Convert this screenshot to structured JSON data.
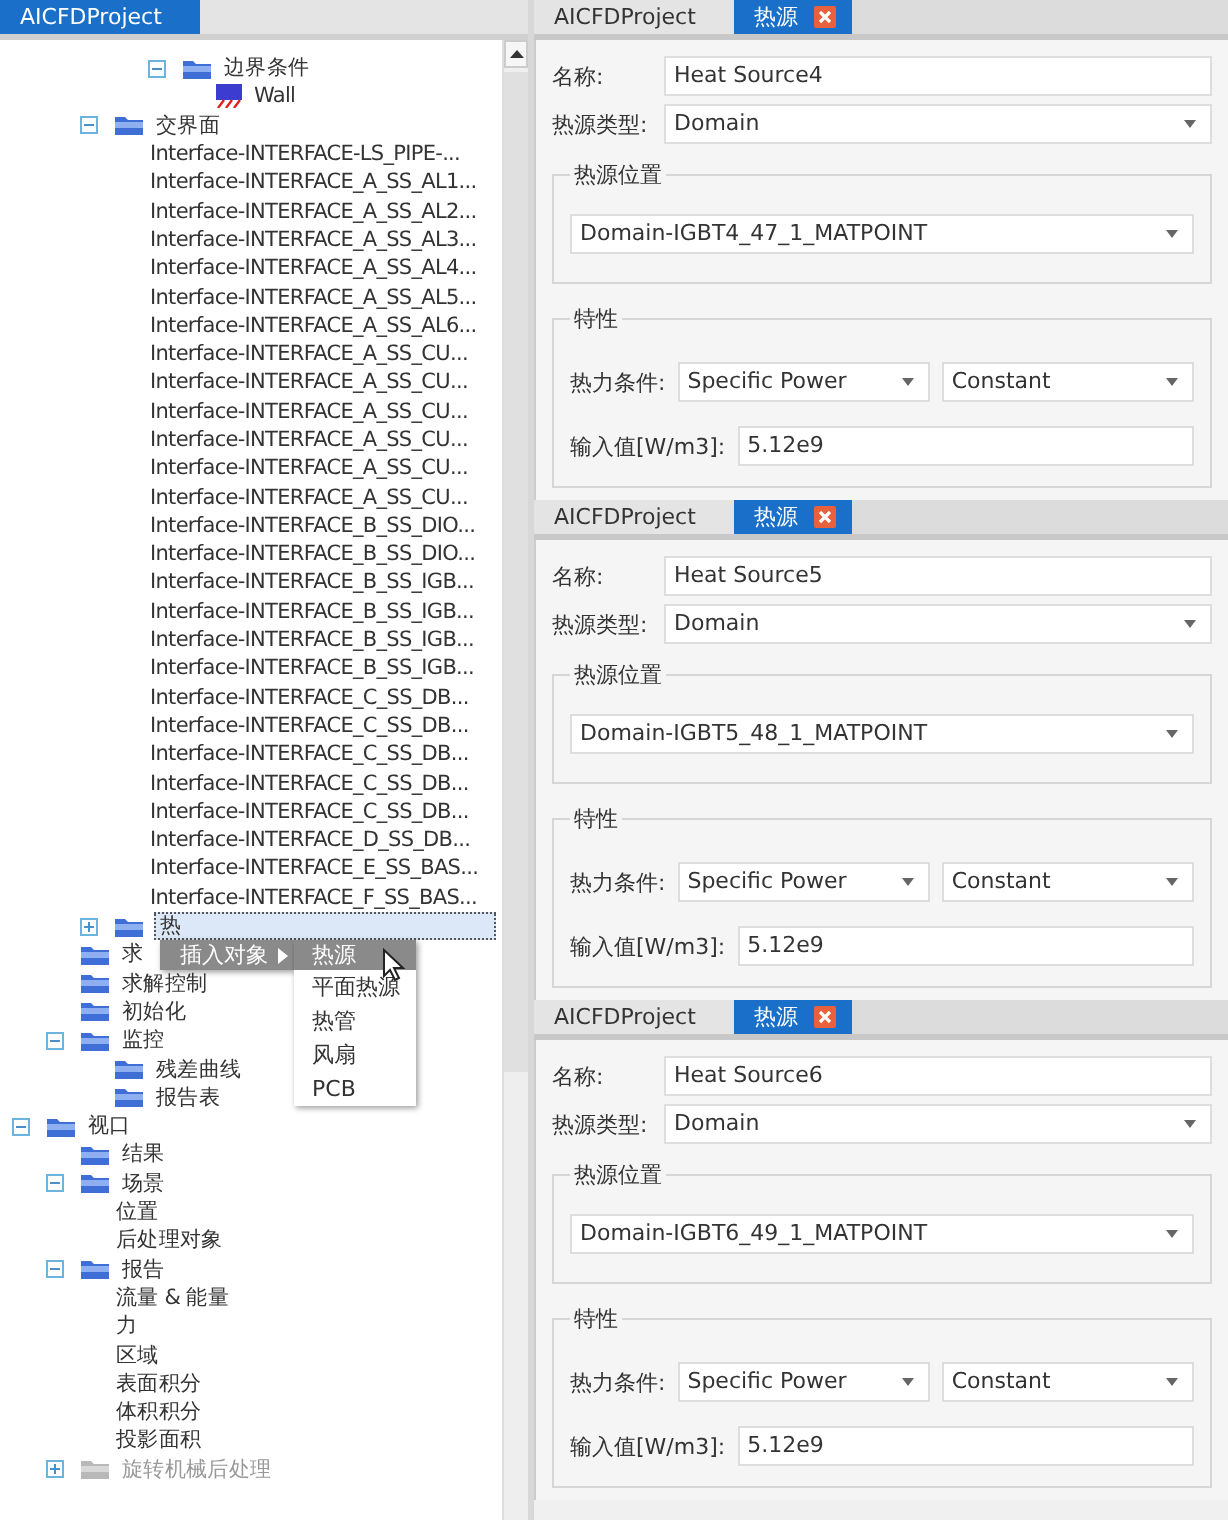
{
  "project_panel": {
    "tab": {
      "label": "AICFDProject",
      "selected": true
    },
    "tree": [
      {
        "children": [
          {
            "children": [
              {
                "children": [
                  {
                    "children": [
                      {
                        "label": "边界条件",
                        "kind": "folder",
                        "expanded": true,
                        "selected": false,
                        "children": [
                          {
                            "label": "Wall",
                            "kind": "wall",
                            "selected": false
                          }
                        ]
                      }
                    ]
                  }
                ]
              },
              {
                "label": "交界面",
                "kind": "folder",
                "expanded": true,
                "selected": false,
                "children": [
                  {
                    "label": "Interface-INTERFACE-LS_PIPE-...",
                    "selected": false
                  },
                  {
                    "label": "Interface-INTERFACE_A_SS_AL1...",
                    "selected": false
                  },
                  {
                    "label": "Interface-INTERFACE_A_SS_AL2...",
                    "selected": false
                  },
                  {
                    "label": "Interface-INTERFACE_A_SS_AL3...",
                    "selected": false
                  },
                  {
                    "label": "Interface-INTERFACE_A_SS_AL4...",
                    "selected": false
                  },
                  {
                    "label": "Interface-INTERFACE_A_SS_AL5...",
                    "selected": false
                  },
                  {
                    "label": "Interface-INTERFACE_A_SS_AL6...",
                    "selected": false
                  },
                  {
                    "label": "Interface-INTERFACE_A_SS_CU...",
                    "selected": false
                  },
                  {
                    "label": "Interface-INTERFACE_A_SS_CU...",
                    "selected": false
                  },
                  {
                    "label": "Interface-INTERFACE_A_SS_CU...",
                    "selected": false
                  },
                  {
                    "label": "Interface-INTERFACE_A_SS_CU...",
                    "selected": false
                  },
                  {
                    "label": "Interface-INTERFACE_A_SS_CU...",
                    "selected": false
                  },
                  {
                    "label": "Interface-INTERFACE_A_SS_CU...",
                    "selected": false
                  },
                  {
                    "label": "Interface-INTERFACE_B_SS_DIO...",
                    "selected": false
                  },
                  {
                    "label": "Interface-INTERFACE_B_SS_DIO...",
                    "selected": false
                  },
                  {
                    "label": "Interface-INTERFACE_B_SS_IGB...",
                    "selected": false
                  },
                  {
                    "label": "Interface-INTERFACE_B_SS_IGB...",
                    "selected": false
                  },
                  {
                    "label": "Interface-INTERFACE_B_SS_IGB...",
                    "selected": false
                  },
                  {
                    "label": "Interface-INTERFACE_B_SS_IGB...",
                    "selected": false
                  },
                  {
                    "label": "Interface-INTERFACE_C_SS_DB...",
                    "selected": false
                  },
                  {
                    "label": "Interface-INTERFACE_C_SS_DB...",
                    "selected": false
                  },
                  {
                    "label": "Interface-INTERFACE_C_SS_DB...",
                    "selected": false
                  },
                  {
                    "label": "Interface-INTERFACE_C_SS_DB...",
                    "selected": false
                  },
                  {
                    "label": "Interface-INTERFACE_C_SS_DB...",
                    "selected": false
                  },
                  {
                    "label": "Interface-INTERFACE_D_SS_DB...",
                    "selected": false
                  },
                  {
                    "label": "Interface-INTERFACE_E_SS_BAS...",
                    "selected": false
                  },
                  {
                    "label": "Interface-INTERFACE_F_SS_BAS...",
                    "selected": false
                  }
                ]
              },
              {
                "label": "热",
                "kind": "folder",
                "expanded": false,
                "selected": true
              }
            ]
          },
          {
            "label": "求",
            "kind": "folder",
            "selected": false
          },
          {
            "label": "求解控制",
            "kind": "folder",
            "selected": false
          },
          {
            "label": "初始化",
            "kind": "folder",
            "selected": false
          },
          {
            "label": "监控",
            "kind": "folder",
            "expanded": true,
            "selected": false,
            "children": [
              {
                "label": "残差曲线",
                "kind": "folder",
                "selected": false
              },
              {
                "label": "报告表",
                "kind": "folder",
                "selected": false
              }
            ]
          }
        ]
      },
      {
        "label": "视口",
        "kind": "folder",
        "expanded": true,
        "selected": false,
        "children": [
          {
            "label": "结果",
            "kind": "folder",
            "selected": false
          },
          {
            "label": "场景",
            "kind": "folder",
            "expanded": true,
            "selected": false,
            "children": [
              {
                "label": "位置",
                "selected": false
              },
              {
                "label": "后处理对象",
                "selected": false
              }
            ]
          },
          {
            "label": "报告",
            "kind": "folder",
            "expanded": true,
            "selected": false,
            "children": [
              {
                "label": "流量 & 能量",
                "selected": false
              },
              {
                "label": "力",
                "selected": false
              },
              {
                "label": "区域",
                "selected": false
              },
              {
                "label": "表面积分",
                "selected": false
              },
              {
                "label": "体积积分",
                "selected": false
              },
              {
                "label": "投影面积",
                "selected": false
              }
            ]
          },
          {
            "label": "旋转机械后处理",
            "kind": "folder-grey",
            "expanded": false,
            "selected": false
          }
        ]
      }
    ],
    "context_menu": {
      "label": "插入对象",
      "submenu": [
        {
          "label": "热源",
          "selected": true
        },
        {
          "label": "平面热源",
          "selected": false
        },
        {
          "label": "热管",
          "selected": false
        },
        {
          "label": "风扇",
          "selected": false
        },
        {
          "label": "PCB",
          "selected": false
        }
      ]
    }
  },
  "heat_source_panels": [
    {
      "tabs": [
        {
          "label": "AICFDProject",
          "selected": false,
          "closable": false
        },
        {
          "label": "热源",
          "selected": true,
          "closable": true
        }
      ],
      "name_label": "名称:",
      "name": "Heat Source4",
      "type_label": "热源类型:",
      "type": "Domain",
      "location_group": "热源位置",
      "location": "Domain-IGBT4_47_1_MATPOINT",
      "properties_group": "特性",
      "condition_label": "热力条件:",
      "condition": "Specific Power",
      "profile": "Constant",
      "value_label": "输入值[W/m3]:",
      "value": "5.12e9"
    },
    {
      "tabs": [
        {
          "label": "AICFDProject",
          "selected": false,
          "closable": false
        },
        {
          "label": "热源",
          "selected": true,
          "closable": true
        }
      ],
      "name_label": "名称:",
      "name": "Heat Source5",
      "type_label": "热源类型:",
      "type": "Domain",
      "location_group": "热源位置",
      "location": "Domain-IGBT5_48_1_MATPOINT",
      "properties_group": "特性",
      "condition_label": "热力条件:",
      "condition": "Specific Power",
      "profile": "Constant",
      "value_label": "输入值[W/m3]:",
      "value": "5.12e9"
    },
    {
      "tabs": [
        {
          "label": "AICFDProject",
          "selected": false,
          "closable": false
        },
        {
          "label": "热源",
          "selected": true,
          "closable": true
        }
      ],
      "name_label": "名称:",
      "name": "Heat Source6",
      "type_label": "热源类型:",
      "type": "Domain",
      "location_group": "热源位置",
      "location": "Domain-IGBT6_49_1_MATPOINT",
      "properties_group": "特性",
      "condition_label": "热力条件:",
      "condition": "Specific Power",
      "profile": "Constant",
      "value_label": "输入值[W/m3]:",
      "value": "5.12e9"
    }
  ]
}
